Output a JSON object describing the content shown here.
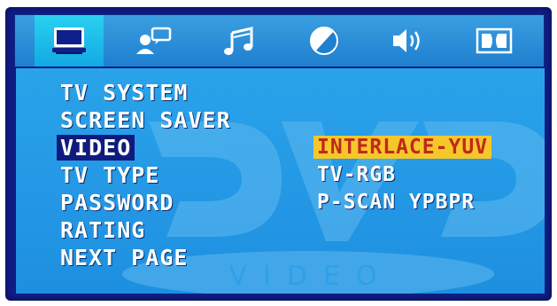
{
  "colors": {
    "frame": "#101c8a",
    "panel": "#1e8fe0",
    "selected_item_bg": "#0f1a80",
    "selected_option_bg": "#f5c72a",
    "selected_option_text": "#c0281c"
  },
  "tabs": [
    {
      "icon": "monitor-icon",
      "active": true
    },
    {
      "icon": "person-speech-icon",
      "active": false
    },
    {
      "icon": "music-note-icon",
      "active": false
    },
    {
      "icon": "half-disc-icon",
      "active": false
    },
    {
      "icon": "speaker-icon",
      "active": false
    },
    {
      "icon": "dolby-icon",
      "active": false
    }
  ],
  "menu": {
    "items": [
      "TV SYSTEM",
      "SCREEN SAVER",
      "VIDEO",
      "TV TYPE",
      "PASSWORD",
      "RATING",
      "NEXT PAGE"
    ],
    "selected": "VIDEO"
  },
  "options": {
    "items": [
      "INTERLACE-YUV",
      "TV-RGB",
      "P-SCAN YPBPR"
    ],
    "selected": "INTERLACE-YUV"
  },
  "watermark": {
    "logo": "DVD",
    "sub": "VIDEO"
  }
}
